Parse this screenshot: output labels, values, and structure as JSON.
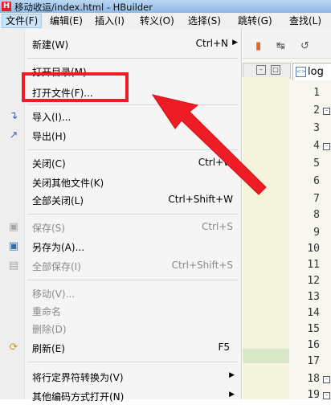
{
  "window": {
    "title": "移动收运/index.html - HBuilder"
  },
  "menubar": {
    "items": [
      {
        "label": "文件(F)"
      },
      {
        "label": "编辑(E)"
      },
      {
        "label": "插入(I)"
      },
      {
        "label": "转义(O)"
      },
      {
        "label": "选择(S)"
      },
      {
        "label": "跳转(G)"
      },
      {
        "label": "查找(L)"
      }
    ]
  },
  "file_menu": {
    "new": {
      "label": "新建(W)",
      "shortcut": "Ctrl+N"
    },
    "open_dir": {
      "label": "打开目录(M)..."
    },
    "open_file": {
      "label": "打开文件(F)..."
    },
    "import": {
      "label": "导入(I)..."
    },
    "export": {
      "label": "导出(H)"
    },
    "close": {
      "label": "关闭(C)",
      "shortcut": "Ctrl+W"
    },
    "close_others": {
      "label": "关闭其他文件(K)"
    },
    "close_all": {
      "label": "全部关闭(L)",
      "shortcut": "Ctrl+Shift+W"
    },
    "save": {
      "label": "保存(S)",
      "shortcut": "Ctrl+S"
    },
    "save_as": {
      "label": "另存为(A)..."
    },
    "save_all": {
      "label": "全部保存(I)",
      "shortcut": "Ctrl+Shift+S"
    },
    "move": {
      "label": "移动(V)..."
    },
    "rename": {
      "label": "重命名"
    },
    "delete": {
      "label": "删除(D)"
    },
    "refresh": {
      "label": "刷新(E)",
      "shortcut": "F5"
    },
    "convert_line": {
      "label": "将行定界符转换为(V)"
    },
    "open_encoding": {
      "label": "其他编码方式打开(N)"
    }
  },
  "editor": {
    "tab_label": "log",
    "line_numbers": [
      "1",
      "2",
      "3",
      "4",
      "5",
      "6",
      "7",
      "8",
      "9",
      "10",
      "11",
      "12",
      "13",
      "14",
      "15",
      "16",
      "17",
      "18",
      "19"
    ]
  },
  "colors": {
    "annotation": "#ee1c24",
    "menu_bg": "#f5f5f5"
  }
}
